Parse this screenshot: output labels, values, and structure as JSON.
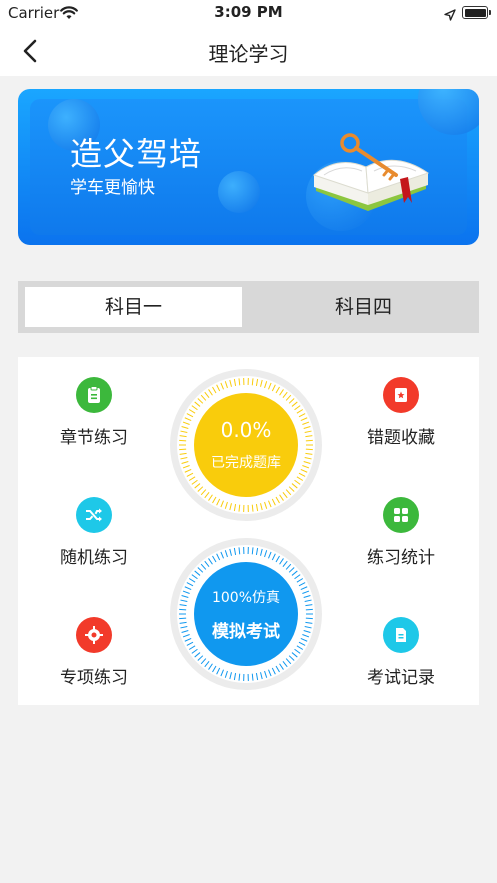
{
  "status_bar": {
    "carrier": "Carrier",
    "time": "3:09 PM"
  },
  "nav": {
    "title": "理论学习",
    "back_icon": "chevron-left-icon"
  },
  "banner": {
    "title": "造父驾培",
    "subtitle": "学车更愉快",
    "image_icon": "book-key-icon"
  },
  "tabs": [
    {
      "label": "科目一",
      "selected": true
    },
    {
      "label": "科目四",
      "selected": false
    }
  ],
  "features": {
    "chapter": {
      "label": "章节练习",
      "icon": "clipboard-icon",
      "color": "#3cb83c"
    },
    "random": {
      "label": "随机练习",
      "icon": "shuffle-icon",
      "color": "#1ec8e8"
    },
    "special": {
      "label": "专项练习",
      "icon": "target-icon",
      "color": "#f23a2a"
    },
    "wrong": {
      "label": "错题收藏",
      "icon": "star-bookmark-icon",
      "color": "#f23a2a"
    },
    "stats": {
      "label": "练习统计",
      "icon": "grid-icon",
      "color": "#3cb83c"
    },
    "records": {
      "label": "考试记录",
      "icon": "document-icon",
      "color": "#1ec8e8"
    }
  },
  "progress": {
    "value_text": "0.0%",
    "fraction": 0.0,
    "label": "已完成题库",
    "color": "#f9cc0c"
  },
  "exam": {
    "tagline": "100%仿真",
    "label": "模拟考试",
    "color": "#1098ef"
  }
}
